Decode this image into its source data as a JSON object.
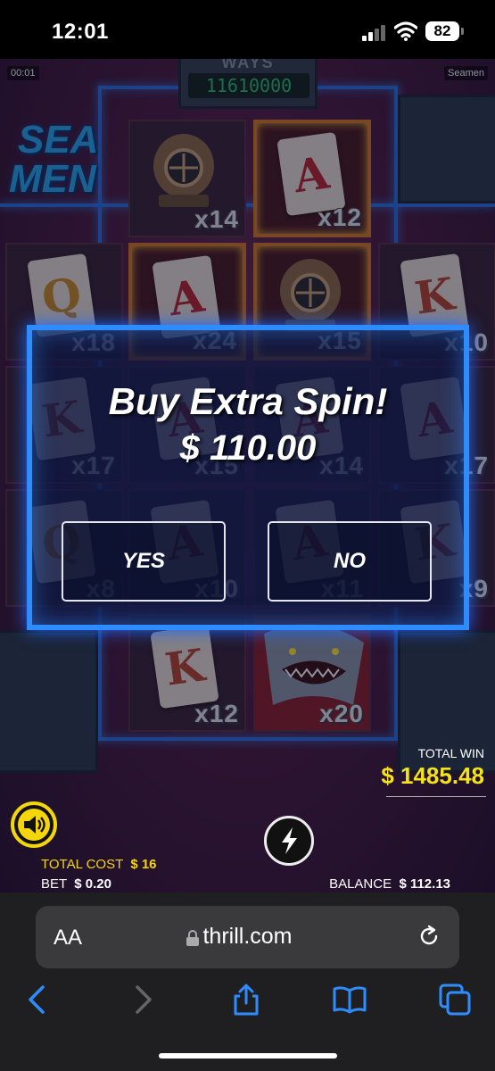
{
  "status": {
    "time": "12:01",
    "battery": "82"
  },
  "game": {
    "timer": "00:01",
    "name": "Seamen",
    "ways_label": "WAYS",
    "ways_value": "11610000",
    "logo_line1": "SEA",
    "logo_line2": "MEN",
    "symbols": [
      {
        "row": 0,
        "col": 1,
        "kind": "helmet",
        "mult": "x14"
      },
      {
        "row": 0,
        "col": 2,
        "kind": "card",
        "letter": "A",
        "mult": "x12",
        "gold": true
      },
      {
        "row": 1,
        "col": 0,
        "kind": "card",
        "letter": "Q",
        "mult": "x18"
      },
      {
        "row": 1,
        "col": 1,
        "kind": "card",
        "letter": "A",
        "mult": "x24",
        "gold": true
      },
      {
        "row": 1,
        "col": 2,
        "kind": "helmet",
        "mult": "x15",
        "gold": true
      },
      {
        "row": 1,
        "col": 3,
        "kind": "card",
        "letter": "K",
        "mult": "x10"
      },
      {
        "row": 2,
        "col": 0,
        "kind": "card",
        "letter": "K",
        "mult": "x17"
      },
      {
        "row": 2,
        "col": 1,
        "kind": "card",
        "letter": "A",
        "mult": "x15"
      },
      {
        "row": 2,
        "col": 2,
        "kind": "card",
        "letter": "A",
        "mult": "x14"
      },
      {
        "row": 2,
        "col": 3,
        "kind": "card",
        "letter": "A",
        "mult": "x17"
      },
      {
        "row": 3,
        "col": 0,
        "kind": "card",
        "letter": "Q",
        "mult": "x8"
      },
      {
        "row": 3,
        "col": 1,
        "kind": "card",
        "letter": "A",
        "mult": "x10"
      },
      {
        "row": 3,
        "col": 2,
        "kind": "card",
        "letter": "A",
        "mult": "x11"
      },
      {
        "row": 3,
        "col": 3,
        "kind": "card",
        "letter": "K",
        "mult": "x9"
      },
      {
        "row": 4,
        "col": 1,
        "kind": "card",
        "letter": "K",
        "mult": "x12"
      },
      {
        "row": 4,
        "col": 2,
        "kind": "shark",
        "mult": "x20"
      }
    ]
  },
  "modal": {
    "title": "Buy Extra Spin!",
    "price": "$ 110.00",
    "yes_label": "YES",
    "no_label": "NO"
  },
  "hud": {
    "total_win_label": "TOTAL WIN",
    "total_win_value": "$ 1485.48",
    "total_cost_label": "TOTAL COST",
    "total_cost_value": "$ 16",
    "bet_label": "BET",
    "bet_value": "$ 0.20",
    "balance_label": "BALANCE",
    "balance_value": "$ 112.13"
  },
  "browser": {
    "aa_label": "AA",
    "url": "thrill.com"
  },
  "colors": {
    "accent_blue": "#2f8cff",
    "win_yellow": "#f5e21a",
    "ways_green": "#2fbf6f"
  }
}
